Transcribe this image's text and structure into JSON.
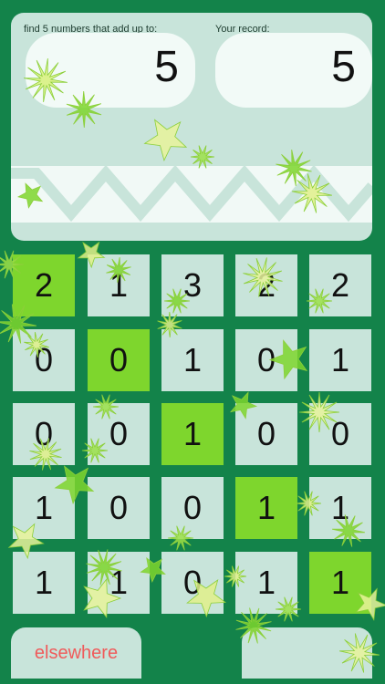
{
  "header": {
    "target_label": "find 5 numbers that add up to:",
    "record_label": "Your record:",
    "target_value": "5",
    "record_value": "5"
  },
  "grid": {
    "rows": [
      [
        {
          "value": "2",
          "selected": true
        },
        {
          "value": "1",
          "selected": false
        },
        {
          "value": "3",
          "selected": false
        },
        {
          "value": "2",
          "selected": false
        },
        {
          "value": "2",
          "selected": false
        }
      ],
      [
        {
          "value": "0",
          "selected": false
        },
        {
          "value": "0",
          "selected": true
        },
        {
          "value": "1",
          "selected": false
        },
        {
          "value": "0",
          "selected": false
        },
        {
          "value": "1",
          "selected": false
        }
      ],
      [
        {
          "value": "0",
          "selected": false
        },
        {
          "value": "0",
          "selected": false
        },
        {
          "value": "1",
          "selected": true
        },
        {
          "value": "0",
          "selected": false
        },
        {
          "value": "0",
          "selected": false
        }
      ],
      [
        {
          "value": "1",
          "selected": false
        },
        {
          "value": "0",
          "selected": false
        },
        {
          "value": "0",
          "selected": false
        },
        {
          "value": "1",
          "selected": true
        },
        {
          "value": "1",
          "selected": false
        }
      ],
      [
        {
          "value": "1",
          "selected": false
        },
        {
          "value": "1",
          "selected": false
        },
        {
          "value": "0",
          "selected": false
        },
        {
          "value": "1",
          "selected": false
        },
        {
          "value": "1",
          "selected": true
        }
      ]
    ]
  },
  "footer": {
    "elsewhere_label": "elsewhere"
  },
  "colors": {
    "background": "#13834a",
    "panel": "#c8e4da",
    "tile": "#c8e4da",
    "tile_selected": "#7ed62d",
    "link_text": "#f05a5a"
  }
}
